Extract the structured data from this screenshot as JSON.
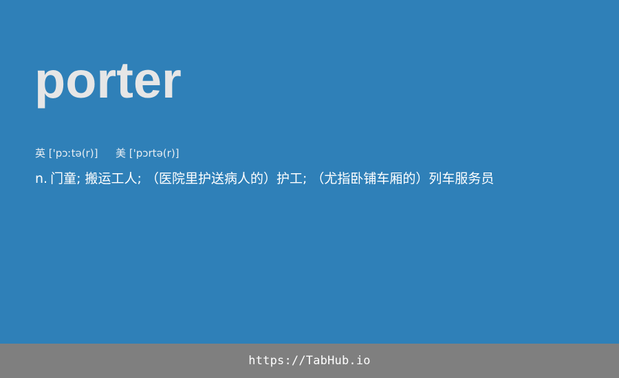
{
  "entry": {
    "word": "porter",
    "phonetics": {
      "uk_label": "英",
      "uk": "['pɔːtə(r)]",
      "us_label": "美",
      "us": "['pɔrtə(r)]"
    },
    "definition": {
      "pos": "n.",
      "text": "门童; 搬运工人; （医院里护送病人的）护工; （尤指卧铺车厢的）列车服务员"
    }
  },
  "footer": {
    "link": "https://TabHub.io"
  },
  "colors": {
    "background": "#2f80b8",
    "footer": "#7f7f7f",
    "word": "#e6e6e6"
  }
}
